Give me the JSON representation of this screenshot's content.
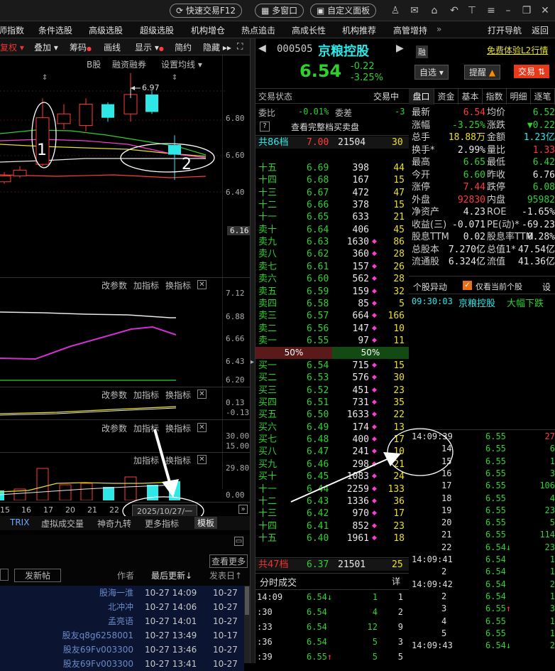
{
  "topbar": {
    "fast_trade": "快速交易F12",
    "multi_window": "多窗口",
    "custom_panel": "自定义面板"
  },
  "menu": {
    "items": [
      "师指数",
      "条件选股",
      "高级选股",
      "超级选股",
      "机构增仓",
      "热点追击",
      "高成长性",
      "机构推荐",
      "高管增持"
    ],
    "more": "»",
    "open_nav": "打开导航",
    "back": "返回"
  },
  "left_toolbar": {
    "items": [
      "复权",
      "叠加",
      "筹码",
      "画线",
      "显示",
      "简约",
      "隐藏"
    ]
  },
  "chart_top": {
    "labels": [
      "B股",
      "融资融券",
      "设置均线"
    ],
    "price_annot": "6.97",
    "axis": [
      "6.80",
      "6.60",
      "6.40",
      "6.16"
    ],
    "marker1": "1",
    "marker2": "2"
  },
  "chart_data": {
    "type": "candlestick",
    "x": [
      "15",
      "16",
      "17",
      "20",
      "21",
      "22",
      "23",
      "24",
      "27"
    ],
    "annotation_high": 6.97,
    "ylim": [
      6.16,
      6.9
    ],
    "candles": [
      {
        "o": 6.41,
        "c": 6.44,
        "h": 6.46,
        "l": 6.4,
        "up": true
      },
      {
        "o": 6.44,
        "c": 6.47,
        "h": 6.49,
        "l": 6.43,
        "up": true
      },
      {
        "o": 6.5,
        "c": 6.74,
        "h": 6.84,
        "l": 6.49,
        "up": true
      },
      {
        "o": 6.71,
        "c": 6.76,
        "h": 6.81,
        "l": 6.68,
        "up": true
      },
      {
        "o": 6.7,
        "c": 6.81,
        "h": 6.84,
        "l": 6.67,
        "up": true
      },
      {
        "o": 6.81,
        "c": 6.74,
        "h": 6.82,
        "l": 6.72,
        "up": false
      },
      {
        "o": 6.76,
        "c": 6.86,
        "h": 6.97,
        "l": 6.72,
        "up": true
      },
      {
        "o": 6.86,
        "c": 6.77,
        "h": 6.88,
        "l": 6.76,
        "up": false
      },
      {
        "o": 6.6,
        "c": 6.55,
        "h": 6.65,
        "l": 6.42,
        "up": false
      }
    ]
  },
  "panels": {
    "p2": {
      "actions": [
        "改参数",
        "加指标",
        "换指标"
      ],
      "axis": [
        "7.12",
        "6.88",
        "6.66",
        "6.43",
        "6.20"
      ]
    },
    "p3": {
      "actions": [
        "改参数",
        "加指标",
        "换指标"
      ],
      "axis": [
        "0.13",
        "-0.13"
      ]
    },
    "p4": {
      "actions": [
        "改参数",
        "加指标",
        "换指标"
      ],
      "axis": [
        "30.00",
        "15.00"
      ]
    },
    "p5": {
      "actions": [
        "加指标",
        "换指标"
      ],
      "axis": [
        "29.80",
        "0.00"
      ]
    }
  },
  "x_axis": {
    "labels": [
      "15",
      "16",
      "17",
      "20",
      "21",
      "22"
    ],
    "date_box": "2025/10/27/一"
  },
  "bottom_tabs": [
    "TRIX",
    "虚拟成交量",
    "神奇九转",
    "更多指标",
    "模板"
  ],
  "forum": {
    "more": "查看更多",
    "post_btn": "发新帖",
    "col_author": "作者",
    "col_last": "最后更新↓",
    "col_posted": "发表日↑",
    "rows": [
      {
        "author": "股海一淮",
        "last": "10-27 14:09",
        "posted": "10-27"
      },
      {
        "author": "北冲冲",
        "last": "10-27 14:06",
        "posted": "10-27"
      },
      {
        "author": "孟亮语",
        "last": "10-27 14:01",
        "posted": "10-27"
      },
      {
        "author": "股友q8g6258001",
        "last": "10-27 13:49",
        "posted": "10-17"
      },
      {
        "author": "股友69Fv003300",
        "last": "10-27 13:46",
        "posted": "10-27"
      },
      {
        "author": "股友69Fv003300",
        "last": "10-27 13:41",
        "posted": "10-27"
      }
    ]
  },
  "stock": {
    "code": "000505",
    "name": "京粮控股",
    "margin_badge": "融",
    "price": "6.54",
    "change": "-0.22",
    "pct": "-3.25%",
    "l2_link": "免费体验L2行情",
    "watchlist": "自选",
    "alert": "提醒",
    "trade": "交易"
  },
  "orderbook": {
    "status_label": "交易状态",
    "status_val": "交易中",
    "weibi_label": "委比",
    "weibi_val": "-0.01%",
    "weicha_label": "委差",
    "weicha_val": "-3",
    "help": "?",
    "full_book": "查看完整档买卖盘",
    "top_label": "共86档",
    "top_price": "7.00",
    "top_vol": "21504",
    "top_n": "30",
    "asks": [
      {
        "l": "十五",
        "p": "6.69",
        "v": "398",
        "d": "c",
        "n": "44"
      },
      {
        "l": "十四",
        "p": "6.68",
        "v": "167",
        "d": "c",
        "n": "15"
      },
      {
        "l": "十三",
        "p": "6.67",
        "v": "472",
        "d": "c",
        "n": "47"
      },
      {
        "l": "十二",
        "p": "6.66",
        "v": "378",
        "d": "c",
        "n": "15"
      },
      {
        "l": "十一",
        "p": "6.65",
        "v": "633",
        "d": "c",
        "n": "21"
      },
      {
        "l": "卖十",
        "p": "6.64",
        "v": "406",
        "d": "c",
        "n": "45"
      },
      {
        "l": "卖九",
        "p": "6.63",
        "v": "1630",
        "d": "◆",
        "n": "86"
      },
      {
        "l": "卖八",
        "p": "6.62",
        "v": "360",
        "d": "◆",
        "n": "28"
      },
      {
        "l": "卖七",
        "p": "6.61",
        "v": "157",
        "d": "◆",
        "n": "26"
      },
      {
        "l": "卖六",
        "p": "6.60",
        "v": "562",
        "d": "◆",
        "n": "28"
      },
      {
        "l": "卖五",
        "p": "6.59",
        "v": "159",
        "d": "◆",
        "n": "32"
      },
      {
        "l": "卖四",
        "p": "6.58",
        "v": "85",
        "d": "◆",
        "n": "5"
      },
      {
        "l": "卖三",
        "p": "6.57",
        "v": "664",
        "d": "◆",
        "n": "166"
      },
      {
        "l": "卖二",
        "p": "6.56",
        "v": "147",
        "d": "◆",
        "n": "10"
      },
      {
        "l": "卖一",
        "p": "6.55",
        "v": "97",
        "d": "◆",
        "n": "11"
      }
    ],
    "ratio_left": "50%",
    "ratio_right": "50%",
    "bids": [
      {
        "l": "买一",
        "p": "6.54",
        "v": "715",
        "d": "◆",
        "n": "15"
      },
      {
        "l": "买二",
        "p": "6.53",
        "v": "576",
        "d": "◆",
        "n": "30"
      },
      {
        "l": "买三",
        "p": "6.52",
        "v": "451",
        "d": "◆",
        "n": "23"
      },
      {
        "l": "买四",
        "p": "6.51",
        "v": "731",
        "d": "◆",
        "n": "35"
      },
      {
        "l": "买五",
        "p": "6.50",
        "v": "1633",
        "d": "◆",
        "n": "22"
      },
      {
        "l": "买六",
        "p": "6.49",
        "v": "174",
        "d": "◆",
        "n": "13"
      },
      {
        "l": "买七",
        "p": "6.48",
        "v": "400",
        "d": "◆",
        "n": "17"
      },
      {
        "l": "买八",
        "p": "6.47",
        "v": "241",
        "d": "◆",
        "n": "10"
      },
      {
        "l": "买九",
        "p": "6.46",
        "v": "298",
        "d": "◆",
        "n": "21"
      },
      {
        "l": "买十",
        "p": "6.45",
        "v": "1083",
        "d": "◆",
        "n": "24"
      },
      {
        "l": "十一",
        "p": "6.44",
        "v": "2259",
        "d": "◆",
        "n": "133"
      },
      {
        "l": "十二",
        "p": "6.43",
        "v": "1336",
        "d": "◆",
        "n": "36"
      },
      {
        "l": "十三",
        "p": "6.42",
        "v": "970",
        "d": "◆",
        "n": "17"
      },
      {
        "l": "十四",
        "p": "6.41",
        "v": "852",
        "d": "◆",
        "n": "23"
      },
      {
        "l": "十五",
        "p": "6.40",
        "v": "1961",
        "d": "◆",
        "n": "18"
      }
    ],
    "bottom_label": "共47档",
    "bottom_price": "6.37",
    "bottom_vol": "21501",
    "bottom_n": "25",
    "tick_title": "分时成交",
    "tick_detail": "详",
    "ticks": [
      {
        "t": "14:09",
        "p": "6.54↓",
        "v": "1",
        "n": "1"
      },
      {
        "t": ":30",
        "p": "6.54",
        "v": "4",
        "n": "2"
      },
      {
        "t": ":33",
        "p": "6.54",
        "v": "12",
        "n": "9"
      },
      {
        "t": ":36",
        "p": "6.54",
        "v": "5",
        "n": "3"
      },
      {
        "t": ":39",
        "p": "6.55↑",
        "v": "5",
        "n": "5"
      }
    ]
  },
  "quote": {
    "tabs": [
      "盘口",
      "资金",
      "基本",
      "指数",
      "明细",
      "逐笔"
    ],
    "rows": [
      {
        "a": "最新",
        "av": "6.54",
        "b": "均价",
        "bv": "6.52"
      },
      {
        "a": "涨幅",
        "av": "-3.25%",
        "b": "涨跌",
        "bv": "▼0.22"
      },
      {
        "a": "总手",
        "av": "18.88万",
        "b": "金额",
        "bv": "1.23亿"
      },
      {
        "a": "换手*",
        "av": "2.99%",
        "b": "量比",
        "bv": "1.33"
      },
      {
        "a": "最高",
        "av": "6.65",
        "b": "最低",
        "bv": "6.42"
      },
      {
        "a": "今开",
        "av": "6.60",
        "b": "昨收",
        "bv": "6.76"
      },
      {
        "a": "涨停",
        "av": "7.44",
        "b": "跌停",
        "bv": "6.08"
      },
      {
        "a": "外盘",
        "av": "92830",
        "b": "内盘",
        "bv": "95982"
      },
      {
        "a": "净资产",
        "av": "4.23",
        "b": "ROE",
        "bv": "-1.65%"
      },
      {
        "a": "收益(三)",
        "av": "-0.071",
        "b": "PE(动)*",
        "bv": "-69.23"
      },
      {
        "a": "股息TTM",
        "av": "0.02",
        "b": "股息率TTM",
        "bv": "0.28%"
      },
      {
        "a": "总股本",
        "av": "7.270亿",
        "b": "总值1*",
        "bv": "47.54亿"
      },
      {
        "a": "流通股",
        "av": "6.324亿",
        "b": "流值",
        "bv": "41.36亿"
      }
    ],
    "anomaly_title": "个股异动",
    "only_current": "仅看当前个股",
    "settings": "设",
    "anomaly_time": "09:30:03",
    "anomaly_name": "京粮控股",
    "anomaly_event": "大幅下跌",
    "ticks": [
      {
        "t": "14:09:39",
        "p": "6.55",
        "v": "27"
      },
      {
        "t": "14",
        "p": "6.55",
        "v": "6"
      },
      {
        "t": "15",
        "p": "6.55",
        "v": "1"
      },
      {
        "t": "16",
        "p": "6.55",
        "v": "3"
      },
      {
        "t": "17",
        "p": "6.55",
        "v": "106"
      },
      {
        "t": "18",
        "p": "6.55",
        "v": "4"
      },
      {
        "t": "19",
        "p": "6.55",
        "v": "23"
      },
      {
        "t": "20",
        "p": "6.55",
        "v": "5"
      },
      {
        "t": "21",
        "p": "6.55",
        "v": "114"
      },
      {
        "t": "22",
        "p": "6.54↓",
        "v": "23"
      },
      {
        "t": "14:09:41",
        "p": "6.54",
        "v": "1"
      },
      {
        "t": "2",
        "p": "6.54",
        "v": "1"
      },
      {
        "t": "14:09:42",
        "p": "6.54",
        "v": "2"
      },
      {
        "t": "2",
        "p": "6.54",
        "v": "1"
      },
      {
        "t": "3",
        "p": "6.55↑",
        "v": "3"
      },
      {
        "t": "4",
        "p": "6.55",
        "v": "1"
      },
      {
        "t": "5",
        "p": "6.55",
        "v": "1"
      },
      {
        "t": "14:09:43",
        "p": "6.54↓",
        "v": "2"
      }
    ]
  },
  "colors": {
    "up": "#ff3b3b",
    "down": "#2fd12f",
    "cyan": "#2ee8e8",
    "accent": "#ff3bd6"
  }
}
